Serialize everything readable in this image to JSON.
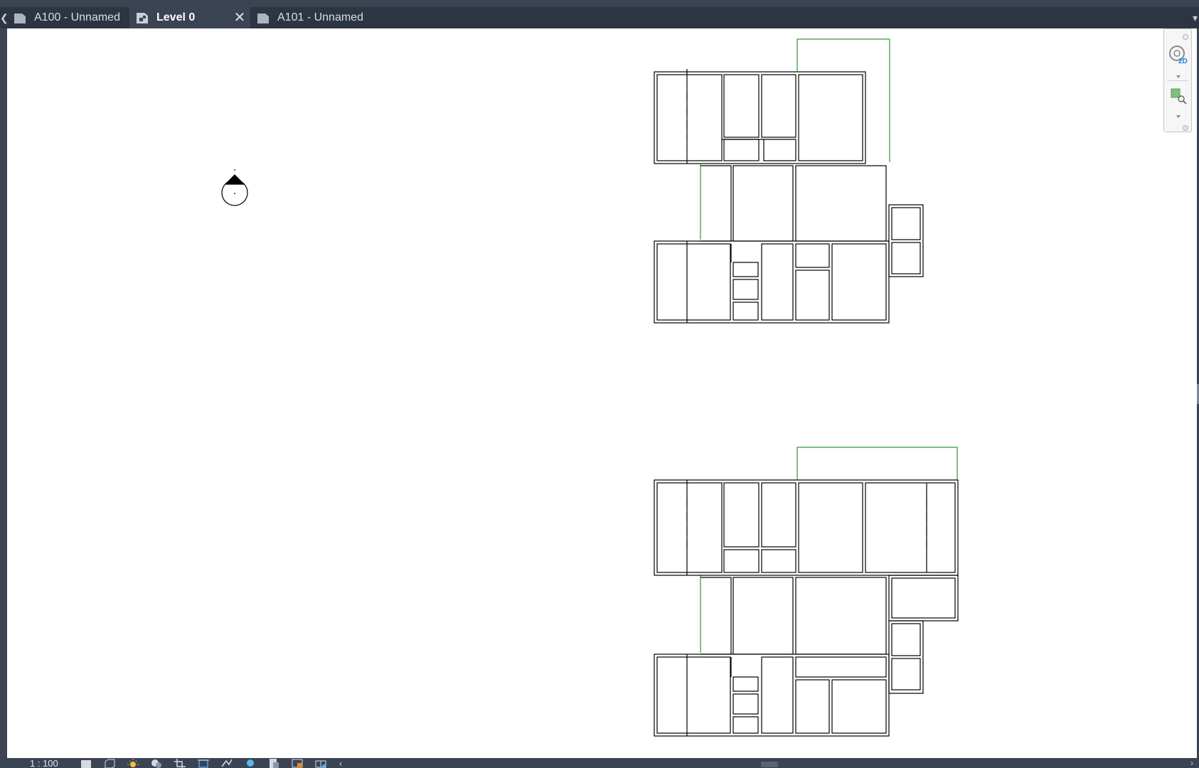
{
  "tabs": [
    {
      "label": "A100 - Unnamed",
      "active": false
    },
    {
      "label": "Level 0",
      "active": true
    },
    {
      "label": "A101 - Unnamed",
      "active": false
    }
  ],
  "tab_close_glyph": "✕",
  "tab_scroll_left_glyph": "❮",
  "tab_dropdown_glyph": "▾",
  "navbar": {
    "wheel_badge": "2D",
    "icons": [
      "close-icon",
      "steering-wheel-2d-icon",
      "chevron-down-icon",
      "zoom-region-icon",
      "chevron-down-icon",
      "settings-icon"
    ]
  },
  "statusbar": {
    "scale": "1 : 100",
    "icons": [
      "detail-level-icon",
      "visual-style-icon",
      "sun-path-icon",
      "shadows-icon",
      "crop-view-icon",
      "show-crop-region-icon",
      "temporary-hide-icon",
      "reveal-hidden-icon",
      "worksharing-icon",
      "temporary-view-properties-icon",
      "analytical-model-icon",
      "highlight-displacement-icon"
    ],
    "collapse_glyph": "‹",
    "scroll_right_glyph": "›"
  },
  "colors": {
    "chrome": "#3b4453",
    "tabbar": "#2e3542",
    "canvas": "#ffffff",
    "wall_line": "#000000",
    "green_line": "#2e9a2e"
  }
}
